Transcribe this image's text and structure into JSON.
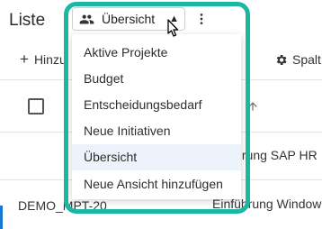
{
  "page": {
    "title": "Liste"
  },
  "toolbar": {
    "add_label": "Hinzu",
    "columns_label": "Spalt",
    "fragment": "r"
  },
  "table": {
    "sort_column_fragment": "e",
    "rows": [
      {
        "id_fragment": "",
        "name_fragment": "ihrung SAP HR"
      },
      {
        "id_fragment": "DEMO_MPT-20",
        "name_fragment": "Einführung Window"
      }
    ]
  },
  "view_selector": {
    "current": "Übersicht",
    "options": [
      "Aktive Projekte",
      "Budget",
      "Entscheidungsbedarf",
      "Neue Initiativen",
      "Übersicht",
      "Neue Ansicht hinzufügen"
    ],
    "active_index": 4
  },
  "colors": {
    "highlight": "#1ab8a2",
    "active_item_bg": "#edf3fa"
  }
}
